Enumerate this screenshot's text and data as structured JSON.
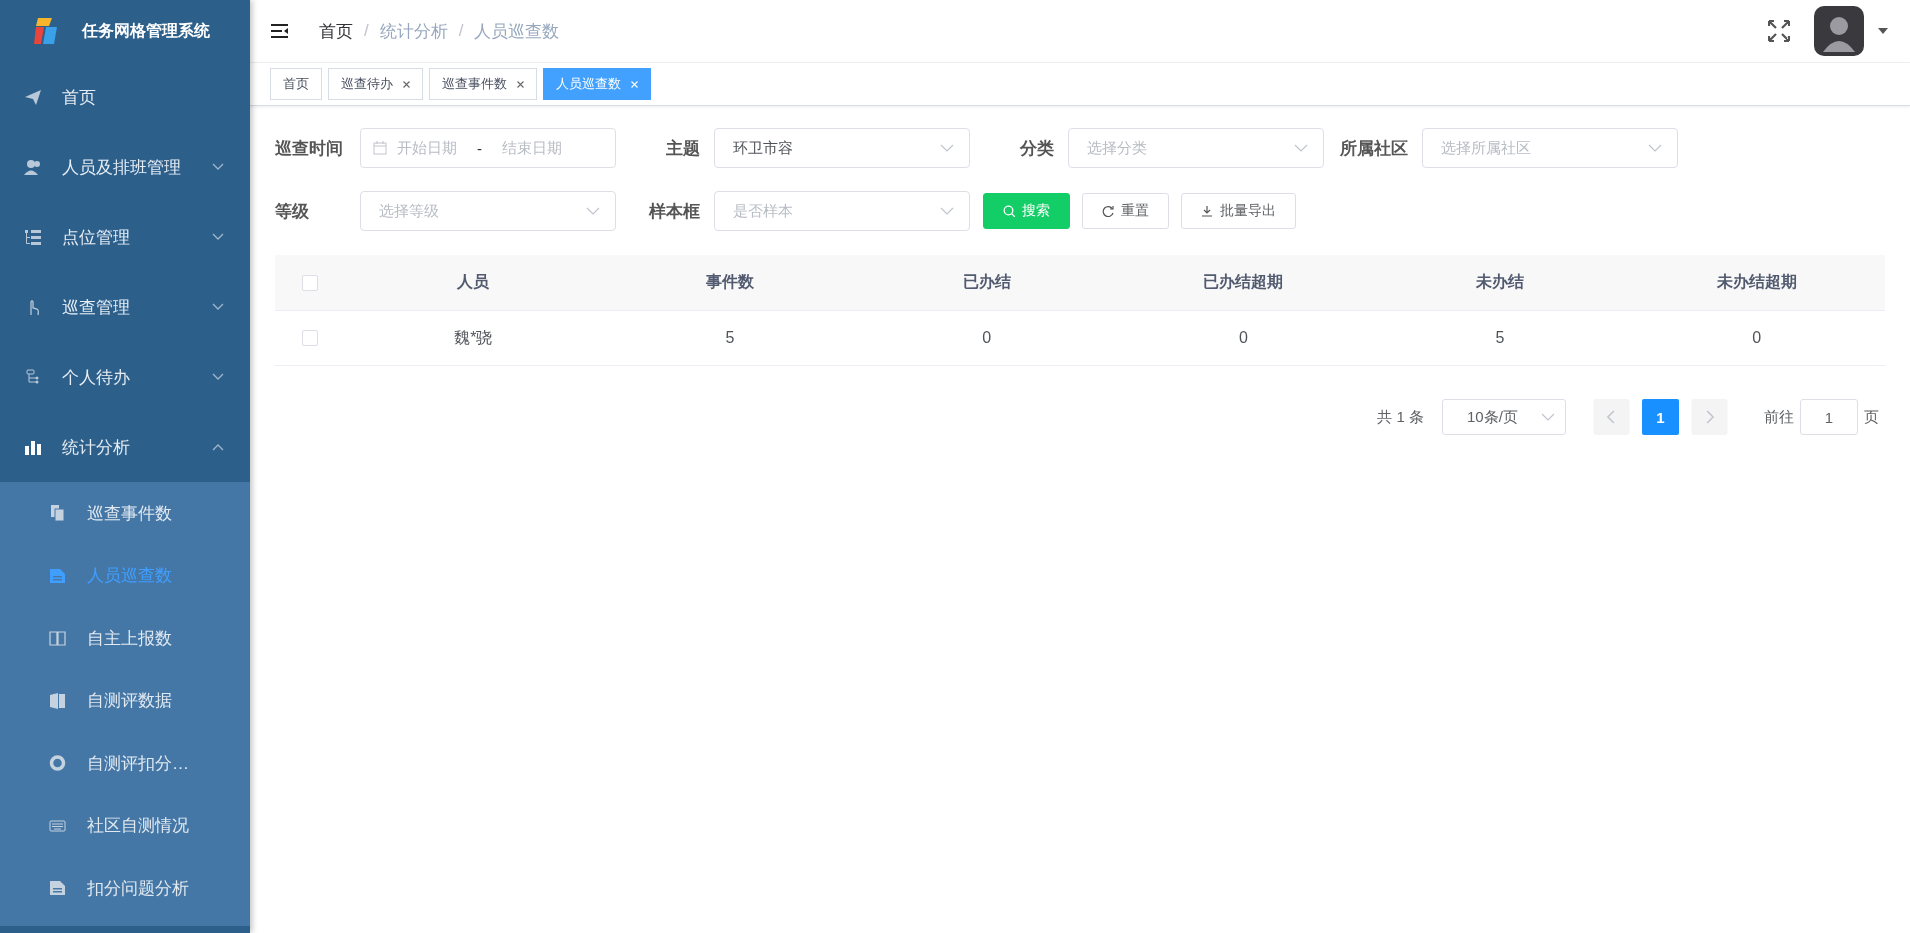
{
  "app": {
    "title": "任务网格管理系统"
  },
  "sidebar": {
    "items": [
      {
        "label": "首页",
        "kind": "link"
      },
      {
        "label": "人员及排班管理",
        "kind": "submenu",
        "expanded": false
      },
      {
        "label": "点位管理",
        "kind": "submenu",
        "expanded": false
      },
      {
        "label": "巡查管理",
        "kind": "submenu",
        "expanded": false
      },
      {
        "label": "个人待办",
        "kind": "submenu",
        "expanded": false
      },
      {
        "label": "统计分析",
        "kind": "submenu",
        "expanded": true,
        "children": [
          {
            "label": "巡查事件数",
            "selected": false
          },
          {
            "label": "人员巡查数",
            "selected": true
          },
          {
            "label": "自主上报数",
            "selected": false
          },
          {
            "label": "自测评数据",
            "selected": false
          },
          {
            "label": "自测评扣分…",
            "selected": false
          },
          {
            "label": "社区自测情况",
            "selected": false
          },
          {
            "label": "扣分问题分析",
            "selected": false
          }
        ]
      }
    ]
  },
  "breadcrumb": [
    {
      "kind": "link",
      "label": "首页",
      "current": false
    },
    {
      "kind": "separator",
      "label": "/"
    },
    {
      "kind": "link",
      "label": "统计分析",
      "current": true
    },
    {
      "kind": "separator",
      "label": "/"
    },
    {
      "kind": "link",
      "label": "人员巡查数",
      "current": true
    }
  ],
  "tags": [
    {
      "label": "首页",
      "closable": false,
      "selected": false
    },
    {
      "label": "巡查待办",
      "closable": true,
      "selected": false
    },
    {
      "label": "巡查事件数",
      "closable": true,
      "selected": false
    },
    {
      "label": "人员巡查数",
      "closable": true,
      "selected": true
    }
  ],
  "filters": {
    "date_range": {
      "label": "巡查时间",
      "start_placeholder": "开始日期",
      "separator": "-",
      "end_placeholder": "结束日期"
    },
    "first_row_selects": [
      {
        "label": "主题",
        "value": "环卫市容"
      },
      {
        "label": "分类",
        "placeholder": "选择分类"
      },
      {
        "label": "所属社区",
        "placeholder": "选择所属社区"
      }
    ],
    "second_row_selects": [
      {
        "label": "等级",
        "placeholder": "选择等级"
      },
      {
        "label": "样本框",
        "placeholder": "是否样本"
      }
    ],
    "buttons": [
      {
        "label": "搜索",
        "kind": "primary"
      },
      {
        "label": "重置",
        "kind": "reset"
      },
      {
        "label": "批量导出",
        "kind": "export"
      }
    ]
  },
  "table": {
    "columns": [
      "人员",
      "事件数",
      "已办结",
      "已办结超期",
      "未办结",
      "未办结超期"
    ],
    "header_checked": false,
    "rows": [
      {
        "checked": false,
        "cells": [
          "魏*骁",
          "5",
          "0",
          "0",
          "5",
          "0"
        ]
      }
    ]
  },
  "pagination": {
    "total": "共 1 条",
    "page_size": "10条/页",
    "pages": [
      {
        "label": "1",
        "selected": true
      }
    ],
    "goto_label": "前往",
    "goto_value": "1",
    "page_suffix": "页"
  }
}
